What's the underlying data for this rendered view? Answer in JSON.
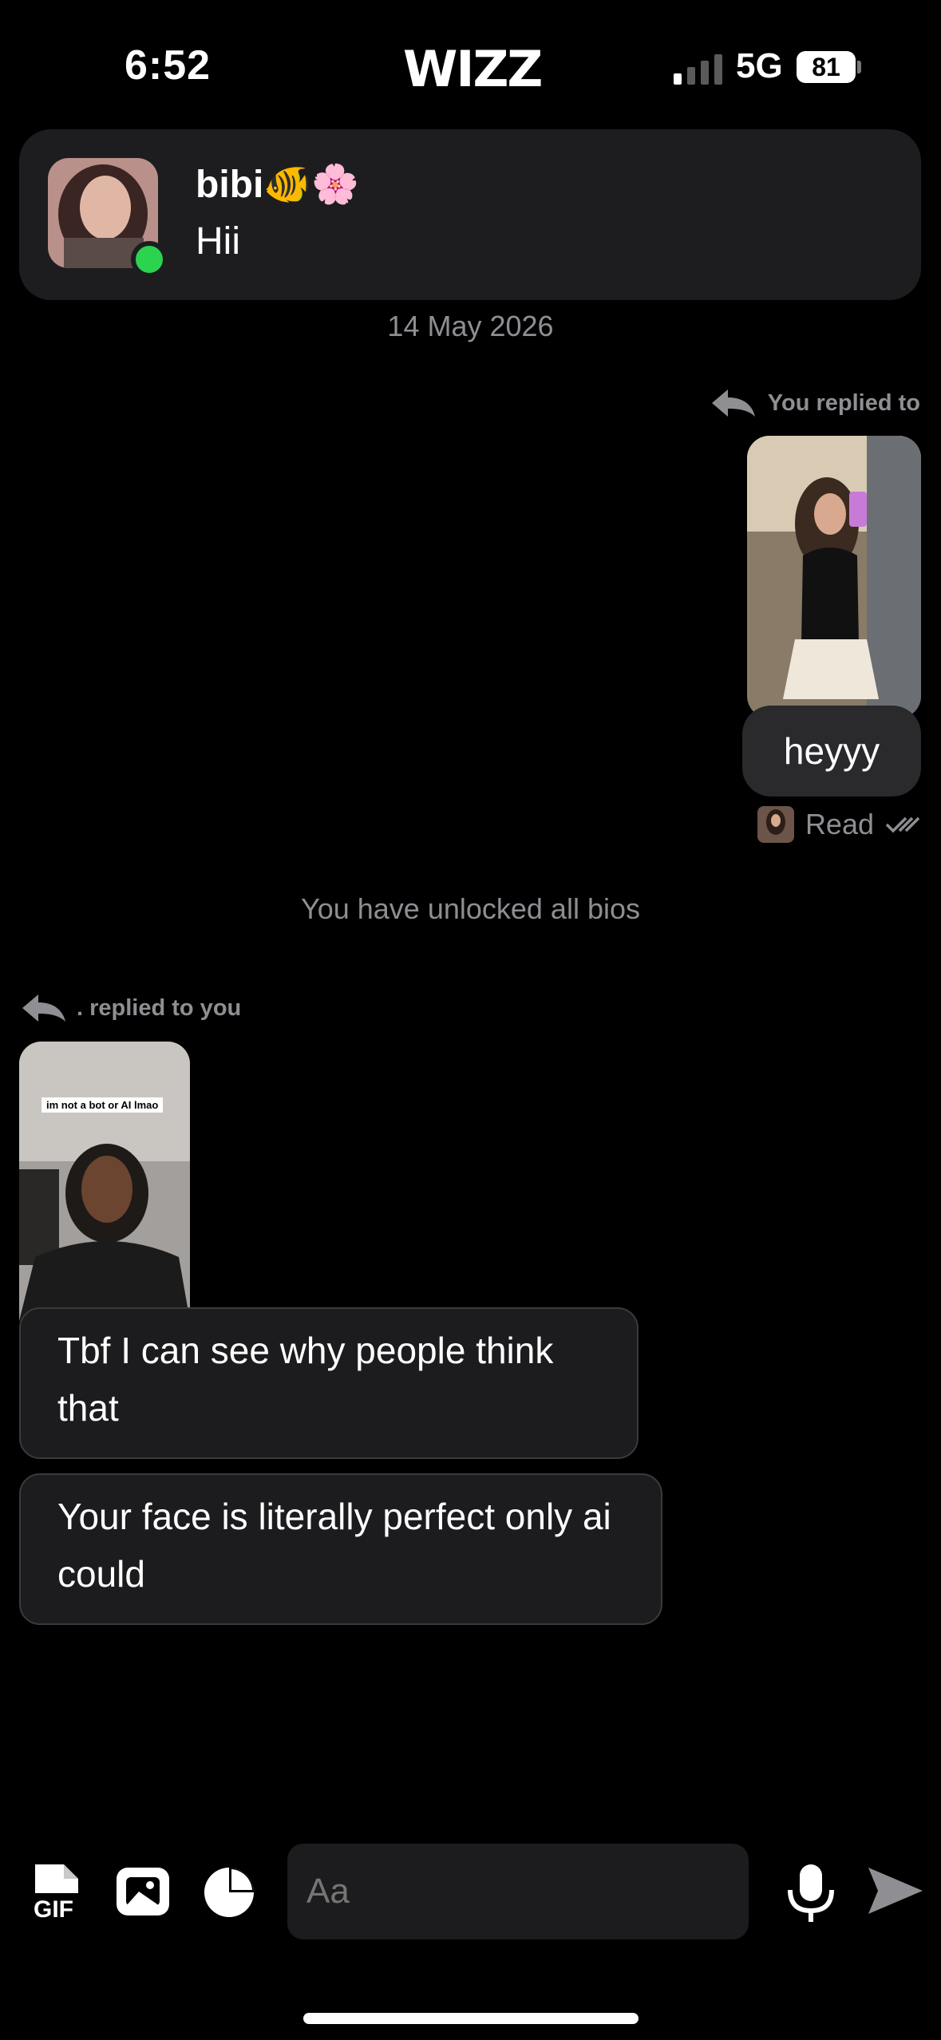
{
  "status": {
    "time": "6:52",
    "app_logo": "WIZZ",
    "network": "5G",
    "battery": "81"
  },
  "header": {
    "contact_name": "bibi🐠🌸",
    "last_message": "Hii",
    "online": true
  },
  "chat": {
    "date_separator": "14 May 2026",
    "outgoing": {
      "reply_label": "You replied to",
      "text": "heyyy",
      "status": "Read"
    },
    "system_notice": "You have unlocked all bios",
    "incoming": {
      "reply_label": ". replied to you",
      "photo_caption": "im not a bot or AI lmao",
      "messages": [
        "Tbf I can see why people think that",
        "Your face is literally perfect only ai could"
      ]
    }
  },
  "composer": {
    "placeholder": "Aa",
    "icons": [
      "gif-icon",
      "image-icon",
      "sticker-icon",
      "microphone-icon",
      "send-icon"
    ]
  },
  "colors": {
    "background": "#000000",
    "card": "#1d1d1f",
    "online": "#2bd34f",
    "muted": "#8e8e93"
  }
}
